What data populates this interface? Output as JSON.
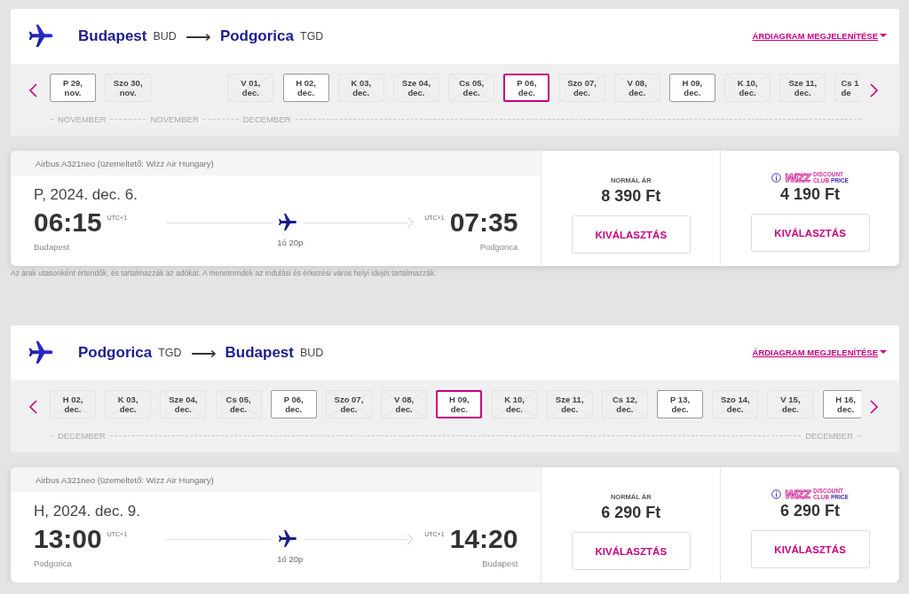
{
  "routes": [
    {
      "origin": {
        "city": "Budapest",
        "code": "BUD"
      },
      "arrow": "⟶",
      "destination": {
        "city": "Podgorica",
        "code": "TGD"
      },
      "price_chart_link": "ÁRDIAGRAM MEGJELENÍTÉSE",
      "date_groups": [
        [
          {
            "day": "P 29,",
            "month": "nov.",
            "available": true,
            "selected": false
          },
          {
            "day": "Szo 30,",
            "month": "nov.",
            "available": false,
            "selected": false
          }
        ],
        [
          {
            "day": "V 01,",
            "month": "dec.",
            "available": false,
            "selected": false
          },
          {
            "day": "H 02,",
            "month": "dec.",
            "available": true,
            "selected": false
          },
          {
            "day": "K 03,",
            "month": "dec.",
            "available": false,
            "selected": false
          },
          {
            "day": "Sze 04,",
            "month": "dec.",
            "available": false,
            "selected": false
          },
          {
            "day": "Cs 05,",
            "month": "dec.",
            "available": false,
            "selected": false
          },
          {
            "day": "P 06,",
            "month": "dec.",
            "available": true,
            "selected": true
          },
          {
            "day": "Szo 07,",
            "month": "dec.",
            "available": false,
            "selected": false
          },
          {
            "day": "V 08,",
            "month": "dec.",
            "available": false,
            "selected": false
          },
          {
            "day": "H 09,",
            "month": "dec.",
            "available": true,
            "selected": false
          },
          {
            "day": "K 10,",
            "month": "dec.",
            "available": false,
            "selected": false
          },
          {
            "day": "Sze 11,",
            "month": "dec.",
            "available": false,
            "selected": false
          },
          {
            "day": "Cs 1",
            "month": "de",
            "available": false,
            "selected": false,
            "partial": true
          }
        ]
      ],
      "months_start": [
        "NOVEMBER",
        "NOVEMBER",
        "DECEMBER"
      ],
      "flight": {
        "aircraft": "Airbus A321neo (üzemeltető: Wizz Air Hungary)",
        "date": "P, 2024. dec. 6.",
        "departure": {
          "time": "06:15",
          "utc": "UTC+1",
          "city": "Budapest"
        },
        "duration": "1ó 20p",
        "arrival": {
          "time": "07:35",
          "utc": "UTC+1",
          "city": "Podgorica"
        },
        "fares": [
          {
            "kind": "normal",
            "label": "NORMÁL ÁR",
            "price": "8 390 Ft",
            "button": "KIVÁLASZTÁS"
          },
          {
            "kind": "club",
            "logo": {
              "brand": "WIZZ",
              "line1": "DISCOUNT",
              "line2a": "CLUB",
              "line2b": "PRICE"
            },
            "price": "4 190 Ft",
            "button": "KIVÁLASZTÁS"
          }
        ]
      },
      "note": "Az árak utasonként értendők, és tartalmazzák az adókat. A menetrendek az indulási és érkezési város helyi idejét tartalmazzák."
    },
    {
      "origin": {
        "city": "Podgorica",
        "code": "TGD"
      },
      "arrow": "⟶",
      "destination": {
        "city": "Budapest",
        "code": "BUD"
      },
      "price_chart_link": "ÁRDIAGRAM MEGJELENÍTÉSE",
      "date_groups": [
        [
          {
            "day": "H 02,",
            "month": "dec.",
            "available": false,
            "selected": false
          },
          {
            "day": "K 03,",
            "month": "dec.",
            "available": false,
            "selected": false
          },
          {
            "day": "Sze 04,",
            "month": "dec.",
            "available": false,
            "selected": false
          },
          {
            "day": "Cs 05,",
            "month": "dec.",
            "available": false,
            "selected": false
          },
          {
            "day": "P 06,",
            "month": "dec.",
            "available": true,
            "selected": false
          },
          {
            "day": "Szo 07,",
            "month": "dec.",
            "available": false,
            "selected": false
          },
          {
            "day": "V 08,",
            "month": "dec.",
            "available": false,
            "selected": false
          },
          {
            "day": "H 09,",
            "month": "dec.",
            "available": true,
            "selected": true
          },
          {
            "day": "K 10,",
            "month": "dec.",
            "available": false,
            "selected": false
          },
          {
            "day": "Sze 11,",
            "month": "dec.",
            "available": false,
            "selected": false
          },
          {
            "day": "Cs 12,",
            "month": "dec.",
            "available": false,
            "selected": false
          },
          {
            "day": "P 13,",
            "month": "dec.",
            "available": true,
            "selected": false
          },
          {
            "day": "Szo 14,",
            "month": "dec.",
            "available": false,
            "selected": false
          },
          {
            "day": "V 15,",
            "month": "dec.",
            "available": false,
            "selected": false
          },
          {
            "day": "H 16,",
            "month": "dec.",
            "available": true,
            "selected": false
          }
        ]
      ],
      "months_start": [
        "DECEMBER"
      ],
      "months_end": [
        "DECEMBER"
      ],
      "flight": {
        "aircraft": "Airbus A321neo (üzemeltető: Wizz Air Hungary)",
        "date": "H, 2024. dec. 9.",
        "departure": {
          "time": "13:00",
          "utc": "UTC+1",
          "city": "Podgorica"
        },
        "duration": "1ó 20p",
        "arrival": {
          "time": "14:20",
          "utc": "UTC+1",
          "city": "Budapest"
        },
        "fares": [
          {
            "kind": "normal",
            "label": "NORMÁL ÁR",
            "price": "6 290 Ft",
            "button": "KIVÁLASZTÁS"
          },
          {
            "kind": "club",
            "logo": {
              "brand": "WIZZ",
              "line1": "DISCOUNT",
              "line2a": "CLUB",
              "line2b": "PRICE"
            },
            "price": "6 290 Ft",
            "button": "KIVÁLASZTÁS"
          }
        ]
      }
    }
  ]
}
